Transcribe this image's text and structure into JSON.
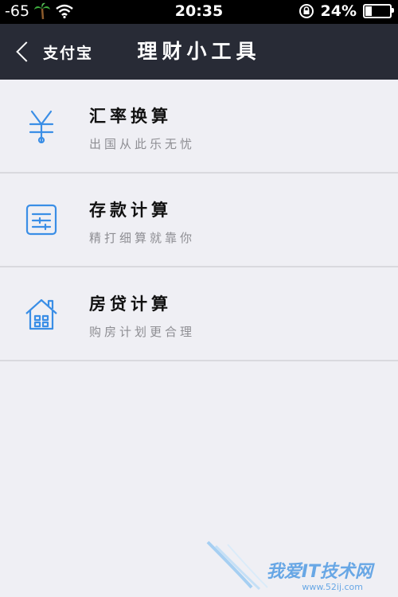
{
  "status_bar": {
    "signal": "-65",
    "time": "20:35",
    "battery": "24%",
    "battery_level": 0.24
  },
  "nav": {
    "back_label": "支付宝",
    "title": "理财小工具"
  },
  "tools": [
    {
      "title": "汇率换算",
      "subtitle": "出国从此乐无忧",
      "icon": "yen-icon"
    },
    {
      "title": "存款计算",
      "subtitle": "精打细算就靠你",
      "icon": "sliders-icon"
    },
    {
      "title": "房贷计算",
      "subtitle": "购房计划更合理",
      "icon": "house-icon"
    }
  ],
  "watermark": {
    "text": "我爱IT技术网",
    "url": "www.52ij.com"
  },
  "colors": {
    "accent": "#3a8ee6",
    "navbar": "#282b36",
    "background": "#efeff4"
  }
}
